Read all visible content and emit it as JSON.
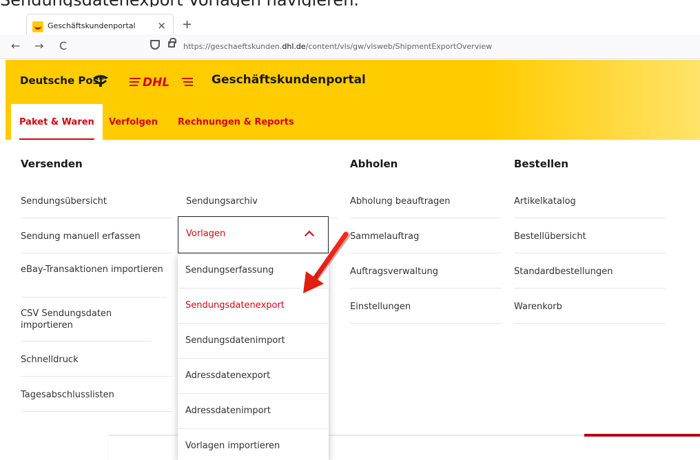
{
  "caption": "Sendungsdatenexport Vorlagen navigieren.",
  "browser": {
    "tab_title": "Geschäftskundenportal",
    "tab_close": "×",
    "new_tab": "+",
    "back": "←",
    "forward": "→",
    "reload": "C",
    "url_prefix": "https://geschaeftskunden.",
    "url_domain": "dhl.de",
    "url_path": "/content/vls/gw/vlsweb/ShipmentExportOverview"
  },
  "header": {
    "brand": "Deutsche Post",
    "dhl": "DHL",
    "portal_title": "Geschäftskundenportal",
    "tabs": [
      {
        "label": "Paket & Waren"
      },
      {
        "label": "Verfolgen"
      },
      {
        "label": "Rechnungen & Reports"
      }
    ]
  },
  "menu": {
    "versenden": {
      "heading": "Versenden",
      "col1": [
        "Sendungsübersicht",
        "Sendung manuell erfassen",
        "eBay-Transaktionen importieren",
        "CSV Sendungsdaten importieren",
        "Schnelldruck",
        "Tagesabschlusslisten"
      ],
      "col2": [
        "Sendungsarchiv",
        "Vorlagen"
      ]
    },
    "abholen": {
      "heading": "Abholen",
      "items": [
        "Abholung beauftragen",
        "Sammelauftrag",
        "Auftragsverwaltung",
        "Einstellungen"
      ]
    },
    "bestellen": {
      "heading": "Bestellen",
      "items": [
        "Artikelkatalog",
        "Bestellübersicht",
        "Standardbestellungen",
        "Warenkorb"
      ]
    },
    "vorlagen_dropdown": [
      "Sendungserfassung",
      "Sendungsdatenexport",
      "Sendungsdatenimport",
      "Adressdatenexport",
      "Adressdatenimport",
      "Vorlagen importieren"
    ]
  },
  "colors": {
    "dhl_yellow": "#ffcc00",
    "dhl_red": "#d40511"
  }
}
